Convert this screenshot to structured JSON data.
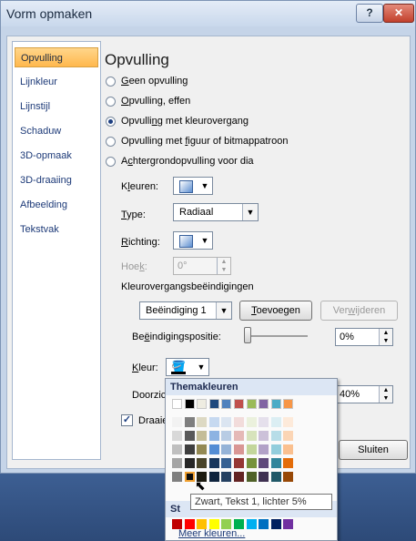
{
  "window": {
    "title": "Vorm opmaken",
    "help": "?",
    "close": "✕"
  },
  "nav": {
    "items": [
      "Opvulling",
      "Lijnkleur",
      "Lijnstijl",
      "Schaduw",
      "3D-opmaak",
      "3D-draaiing",
      "Afbeelding",
      "Tekstvak"
    ],
    "selected": "Opvulling"
  },
  "panel": {
    "heading": "Opvulling",
    "options": [
      {
        "pre": "",
        "u": "G",
        "post": "een opvulling",
        "selected": false
      },
      {
        "pre": "",
        "u": "O",
        "post": "pvulling, effen",
        "selected": false
      },
      {
        "pre": "Opvulli",
        "u": "n",
        "post": "g met kleurovergang",
        "selected": true
      },
      {
        "pre": "Opvulling met ",
        "u": "f",
        "post": "iguur of bitmappatroon",
        "selected": false
      },
      {
        "pre": "A",
        "u": "c",
        "post": "htergrondopvulling voor dia",
        "selected": false
      }
    ],
    "kleuren_label": {
      "pre": "K",
      "u": "l",
      "post": "euren:"
    },
    "type_label": {
      "pre": "",
      "u": "T",
      "post": "ype:"
    },
    "type_value": "Radiaal",
    "richting_label": {
      "pre": "",
      "u": "R",
      "post": "ichting:"
    },
    "hoek_label": {
      "pre": "Hoe",
      "u": "k",
      "post": ":"
    },
    "hoek_value": "0°",
    "stops_group": "Kleurovergangsbeëindigingen",
    "stop_value": "Beëindiging 1",
    "add_button": {
      "pre": "",
      "u": "T",
      "post": "oevoegen"
    },
    "remove_button": {
      "pre": "Ver",
      "u": "w",
      "post": "ijderen"
    },
    "position_label": {
      "pre": "Be",
      "u": "ë",
      "post": "indigingspositie:"
    },
    "position_value": "0%",
    "kleur_label": {
      "pre": "",
      "u": "K",
      "post": "leur:"
    },
    "transparency_label": "Doorzich",
    "transparency_value": "40%",
    "rotate_label": "Draaie",
    "rotate_checked": true,
    "close_button": "Sluiten"
  },
  "color_popup": {
    "theme_header": "Themakleuren",
    "standard_header": "St",
    "tooltip": "Zwart, Tekst 1, lichter 5%",
    "more": "Meer kleuren...",
    "theme_top": [
      "#ffffff",
      "#000000",
      "#eeece1",
      "#1f497d",
      "#4f81bd",
      "#c0504d",
      "#9bbb59",
      "#8064a2",
      "#4bacc6",
      "#f79646"
    ],
    "theme_shades": [
      [
        "#f2f2f2",
        "#7f7f7f",
        "#ddd9c3",
        "#c6d9f0",
        "#dbe5f1",
        "#f2dcdb",
        "#ebf1dd",
        "#e5e0ec",
        "#dbeef3",
        "#fdeada"
      ],
      [
        "#d8d8d8",
        "#595959",
        "#c4bd97",
        "#8db3e2",
        "#b8cce4",
        "#e5b9b7",
        "#d7e3bc",
        "#ccc1d9",
        "#b7dde8",
        "#fbd5b5"
      ],
      [
        "#bfbfbf",
        "#3f3f3f",
        "#938953",
        "#548dd4",
        "#95b3d7",
        "#d99694",
        "#c3d69b",
        "#b2a2c7",
        "#92cddc",
        "#fac08f"
      ],
      [
        "#a5a5a5",
        "#262626",
        "#494429",
        "#17365d",
        "#366092",
        "#953734",
        "#76923c",
        "#5f497a",
        "#31859b",
        "#e36c09"
      ],
      [
        "#7f7f7f",
        "#0c0c0c",
        "#1d1b10",
        "#0f243e",
        "#244061",
        "#632423",
        "#4f6128",
        "#3f3151",
        "#205867",
        "#974806"
      ]
    ],
    "standard": [
      "#c00000",
      "#ff0000",
      "#ffc000",
      "#ffff00",
      "#92d050",
      "#00b050",
      "#00b0f0",
      "#0070c0",
      "#002060",
      "#7030a0"
    ]
  }
}
